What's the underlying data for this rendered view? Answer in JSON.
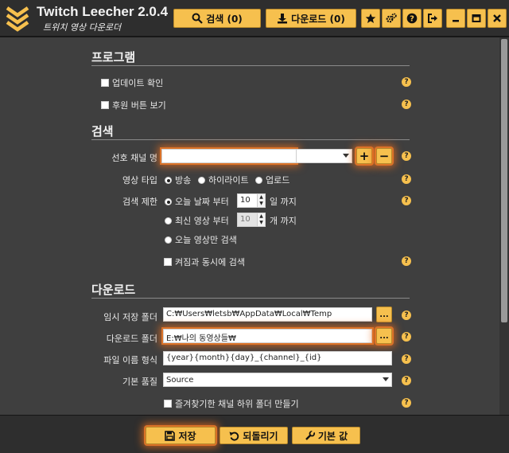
{
  "app": {
    "title": "Twitch Leecher 2.0.4",
    "subtitle": "트위치 영상 다운로더"
  },
  "toolbar": {
    "search_label": "검색 (0)",
    "download_label": "다운로드 (0)"
  },
  "sections": {
    "program": {
      "title": "프로그램",
      "update_check": "업데이트 확인",
      "show_donate": "후원 버튼 보기"
    },
    "search": {
      "title": "검색",
      "preferred_channel_label": "선호 채널 명",
      "preferred_channel_value": "",
      "add_label": "+",
      "remove_label": "−",
      "video_type_label": "영상 타입",
      "video_types": [
        "방송",
        "하이라이트",
        "업로드"
      ],
      "video_type_selected": "방송",
      "search_limit_label": "검색 제한",
      "limit_days_prefix": "오늘 날짜 부터",
      "limit_days_value": "10",
      "limit_days_suffix": "일 까지",
      "limit_count_prefix": "최신 영상 부터",
      "limit_count_value": "10",
      "limit_count_suffix": "개 까지",
      "limit_today_only": "오늘 영상만 검색",
      "search_on_start": "켜짐과 동시에 검색"
    },
    "download": {
      "title": "다운로드",
      "temp_folder_label": "임시 저장 폴더",
      "temp_folder_value": "C:₩Users₩letsb₩AppData₩Local₩Temp",
      "download_folder_label": "다운로드 폴더",
      "download_folder_value": "E:₩나의 동영상들₩",
      "browse_label": "...",
      "filename_format_label": "파일 이름 형식",
      "filename_format_value": "{year}{month}{day}_{channel}_{id}",
      "default_quality_label": "기본 품질",
      "default_quality_value": "Source",
      "favorite_subfolder": "즐겨찾기한 채널 하위 폴더 만들기"
    }
  },
  "help_label": "?",
  "footer": {
    "save_label": "저장",
    "revert_label": "되돌리기",
    "defaults_label": "기본 값"
  },
  "colors": {
    "accent": "#f6c04e",
    "background": "#3f3f3f",
    "bar": "#2e2e2e",
    "highlight": "#e87828"
  }
}
